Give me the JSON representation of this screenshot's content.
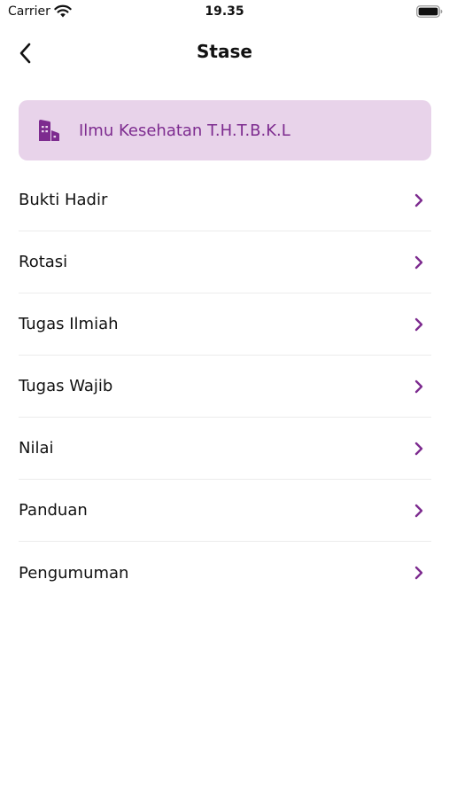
{
  "status_bar": {
    "carrier": "Carrier",
    "time": "19.35",
    "wifi_icon": "wifi-icon",
    "battery_icon": "battery-icon"
  },
  "nav": {
    "back_icon": "chevron-left-icon",
    "title": "Stase"
  },
  "stase_card": {
    "icon": "building-icon",
    "label": "Ilmu Kesehatan T.H.T.B.K.L",
    "background": "#e8d3ea",
    "text_color": "#7d2b8f"
  },
  "menu": {
    "items": [
      {
        "label": "Bukti Hadir"
      },
      {
        "label": "Rotasi"
      },
      {
        "label": "Tugas Ilmiah"
      },
      {
        "label": "Tugas Wajib"
      },
      {
        "label": "Nilai"
      },
      {
        "label": "Panduan"
      },
      {
        "label": "Pengumuman"
      }
    ],
    "chevron_icon": "chevron-right-icon",
    "accent_color": "#7d2b8f"
  }
}
